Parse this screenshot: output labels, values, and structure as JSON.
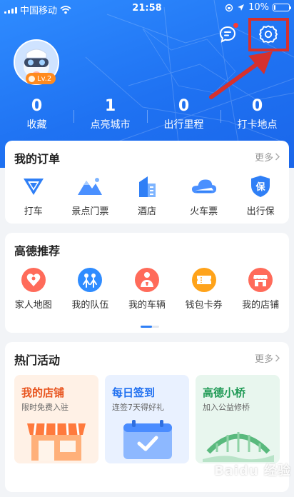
{
  "status_bar": {
    "carrier": "中国移动",
    "time": "21:58",
    "battery": "10%"
  },
  "profile": {
    "level": "Lv.2"
  },
  "stats": [
    {
      "value": "0",
      "label": "收藏"
    },
    {
      "value": "1",
      "label": "点亮城市"
    },
    {
      "value": "0",
      "label": "出行里程"
    },
    {
      "value": "0",
      "label": "打卡地点"
    }
  ],
  "orders": {
    "title": "我的订单",
    "more": "更多",
    "items": [
      {
        "label": "打车",
        "icon": "taxi-icon"
      },
      {
        "label": "景点门票",
        "icon": "mountain-icon"
      },
      {
        "label": "酒店",
        "icon": "hotel-icon"
      },
      {
        "label": "火车票",
        "icon": "train-icon"
      },
      {
        "label": "出行保",
        "icon": "shield-icon"
      }
    ]
  },
  "recommend": {
    "title": "高德推荐",
    "items": [
      {
        "label": "家人地图",
        "icon": "family-map-icon"
      },
      {
        "label": "我的队伍",
        "icon": "team-icon"
      },
      {
        "label": "我的车辆",
        "icon": "car-icon"
      },
      {
        "label": "钱包卡券",
        "icon": "ticket-icon"
      },
      {
        "label": "我的店铺",
        "icon": "shop-icon"
      }
    ]
  },
  "activities": {
    "title": "热门活动",
    "more": "更多",
    "cards": [
      {
        "title": "我的店铺",
        "subtitle": "限时免费入驻"
      },
      {
        "title": "每日签到",
        "subtitle": "连签7天得好礼"
      },
      {
        "title": "高德小桥",
        "subtitle": "加入公益修桥"
      }
    ]
  },
  "watermark": "Baidu 经验",
  "colors": {
    "brand_blue": "#1f72f2",
    "highlight_red": "#d6312d",
    "badge_orange": "#ff8a1e"
  }
}
